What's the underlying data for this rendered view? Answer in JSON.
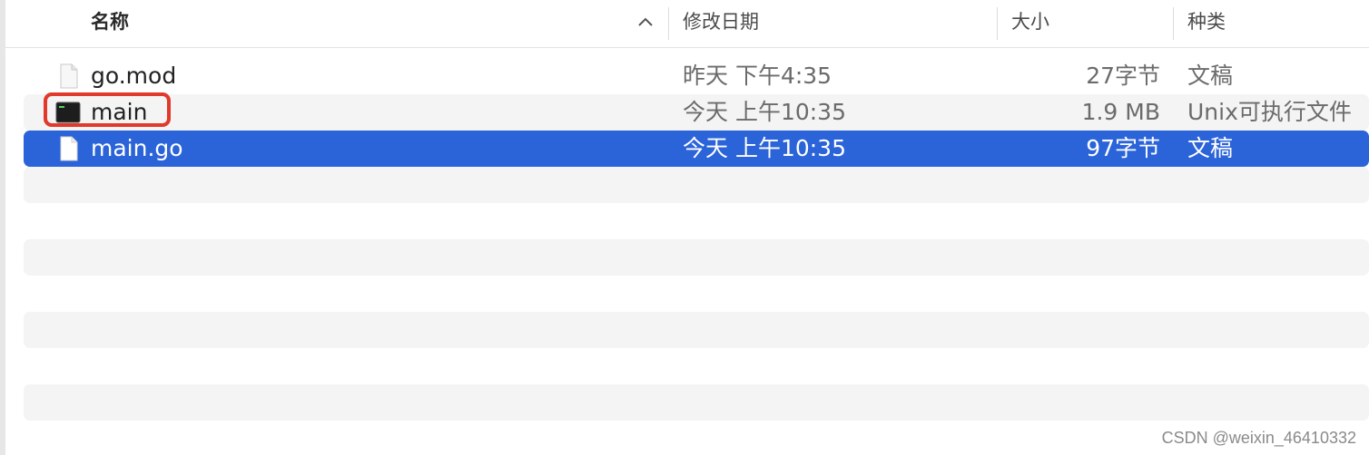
{
  "header": {
    "name": "名称",
    "date": "修改日期",
    "size": "大小",
    "kind": "种类",
    "sort_icon": "chevron-up-icon"
  },
  "rows": [
    {
      "icon": "document-icon",
      "name": "go.mod",
      "date": "昨天 下午4:35",
      "size": "27字节",
      "kind": "文稿"
    },
    {
      "icon": "terminal-executable-icon",
      "name": "main",
      "date": "今天 上午10:35",
      "size": "1.9 MB",
      "kind": "Unix可执行文件"
    },
    {
      "icon": "document-icon",
      "name": "main.go",
      "date": "今天 上午10:35",
      "size": "97字节",
      "kind": "文稿"
    }
  ],
  "selection_color": "#2b63d9",
  "highlight_color": "#e1392b",
  "watermark": "CSDN @weixin_46410332"
}
